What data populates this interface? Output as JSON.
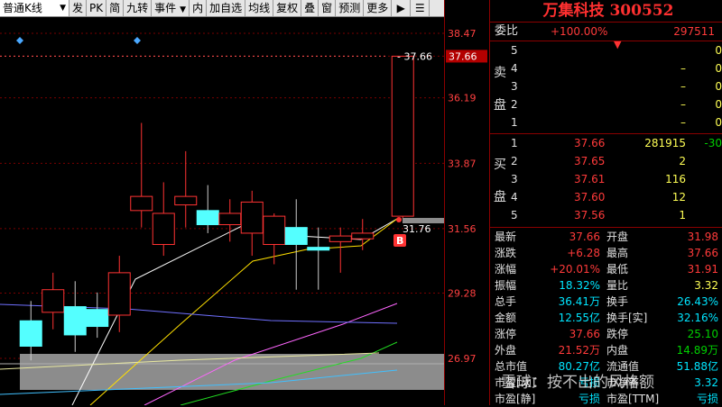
{
  "toolbar": {
    "period_select": "普通K线",
    "buttons": [
      "发",
      "PK",
      "简",
      "九转",
      "事件",
      "内",
      "加自选",
      "均线",
      "复权",
      "叠",
      "窗",
      "预测",
      "更多"
    ],
    "settings_icon": "gear-icon",
    "more_icon": "play-icon"
  },
  "stock": {
    "name": "万集科技",
    "code": "300552",
    "title": "万集科技 300552"
  },
  "chart": {
    "price_axis": [
      "38.47",
      "37.66",
      "36.19",
      "33.87",
      "31.56",
      "29.28",
      "26.97"
    ],
    "max_label": "37.66",
    "last_price_label": "31.76",
    "buy_marker": "B"
  },
  "chart_data": {
    "type": "candlestick",
    "ylim": [
      26.2,
      38.9
    ],
    "candles": [
      {
        "o": 28.3,
        "h": 29.0,
        "l": 26.9,
        "c": 27.4
      },
      {
        "o": 28.6,
        "h": 30.0,
        "l": 28.0,
        "c": 29.4
      },
      {
        "o": 28.8,
        "h": 29.7,
        "l": 27.2,
        "c": 27.8
      },
      {
        "o": 28.7,
        "h": 29.3,
        "l": 27.7,
        "c": 28.1
      },
      {
        "o": 28.5,
        "h": 30.6,
        "l": 27.9,
        "c": 30.0
      },
      {
        "o": 32.2,
        "h": 35.3,
        "l": 31.6,
        "c": 32.7
      },
      {
        "o": 31.0,
        "h": 33.2,
        "l": 30.6,
        "c": 32.1
      },
      {
        "o": 32.4,
        "h": 34.3,
        "l": 31.6,
        "c": 32.7
      },
      {
        "o": 32.2,
        "h": 33.1,
        "l": 31.4,
        "c": 31.7
      },
      {
        "o": 31.7,
        "h": 32.6,
        "l": 31.1,
        "c": 32.1
      },
      {
        "o": 31.4,
        "h": 32.9,
        "l": 30.6,
        "c": 32.5
      },
      {
        "o": 31.0,
        "h": 32.1,
        "l": 30.3,
        "c": 32.0
      },
      {
        "o": 31.6,
        "h": 32.6,
        "l": 29.4,
        "c": 31.0
      },
      {
        "o": 30.9,
        "h": 31.6,
        "l": 29.4,
        "c": 30.8
      },
      {
        "o": 31.1,
        "h": 31.6,
        "l": 30.0,
        "c": 31.3
      },
      {
        "o": 31.2,
        "h": 31.9,
        "l": 30.8,
        "c": 31.4
      },
      {
        "o": 32.0,
        "h": 37.66,
        "l": 31.9,
        "c": 37.66
      }
    ]
  },
  "weibi": {
    "label": "委比",
    "pct": "+100.00%",
    "val": "297511"
  },
  "sell_label": "卖盘",
  "buy_label": "买盘",
  "sell": [
    {
      "n": "5",
      "p": "",
      "v": "",
      "d": "0"
    },
    {
      "n": "4",
      "p": "",
      "v": "–",
      "d": "0"
    },
    {
      "n": "3",
      "p": "",
      "v": "–",
      "d": "0"
    },
    {
      "n": "2",
      "p": "",
      "v": "–",
      "d": "0"
    },
    {
      "n": "1",
      "p": "",
      "v": "–",
      "d": "0"
    }
  ],
  "buy": [
    {
      "n": "1",
      "p": "37.66",
      "v": "281915",
      "d": "-30"
    },
    {
      "n": "2",
      "p": "37.65",
      "v": "2",
      "d": ""
    },
    {
      "n": "3",
      "p": "37.61",
      "v": "116",
      "d": ""
    },
    {
      "n": "4",
      "p": "37.60",
      "v": "12",
      "d": ""
    },
    {
      "n": "5",
      "p": "37.56",
      "v": "1",
      "d": ""
    }
  ],
  "stats": [
    {
      "l1": "最新",
      "v1": "37.66",
      "c1": "red",
      "l2": "开盘",
      "v2": "31.98",
      "c2": "red"
    },
    {
      "l1": "涨跌",
      "v1": "+6.28",
      "c1": "red",
      "l2": "最高",
      "v2": "37.66",
      "c2": "red"
    },
    {
      "l1": "涨幅",
      "v1": "+20.01%",
      "c1": "red",
      "l2": "最低",
      "v2": "31.91",
      "c2": "red"
    },
    {
      "l1": "振幅",
      "v1": "18.32%",
      "c1": "cyan",
      "l2": "量比",
      "v2": "3.32",
      "c2": "yel"
    },
    {
      "l1": "总手",
      "v1": "36.41万",
      "c1": "cyan",
      "l2": "换手",
      "v2": "26.43%",
      "c2": "cyan"
    },
    {
      "l1": "金额",
      "v1": "12.55亿",
      "c1": "cyan",
      "l2": "换手[实]",
      "v2": "32.16%",
      "c2": "cyan"
    },
    {
      "l1": "涨停",
      "v1": "37.66",
      "c1": "red",
      "l2": "跌停",
      "v2": "25.10",
      "c2": "grn"
    },
    {
      "l1": "外盘",
      "v1": "21.52万",
      "c1": "red",
      "l2": "内盘",
      "v2": "14.89万",
      "c2": "grn"
    },
    {
      "l1": "总市值",
      "v1": "80.27亿",
      "c1": "cyan",
      "l2": "流通值",
      "v2": "51.88亿",
      "c2": "cyan"
    },
    {
      "l1": "市盈[动]",
      "v1": "亏损",
      "c1": "cyan",
      "l2": "市净率",
      "v2": "3.32",
      "c2": "cyan"
    },
    {
      "l1": "市盈[静]",
      "v1": "亏损",
      "c1": "cyan",
      "l2": "市盈[TTM]",
      "v2": "亏损",
      "c2": "cyan"
    }
  ],
  "watermark": "雪球：按不出的风格额",
  "colors": {
    "up": "#ff3333",
    "down": "#54ffff",
    "bg": "#000000",
    "grid": "#8b0000"
  }
}
